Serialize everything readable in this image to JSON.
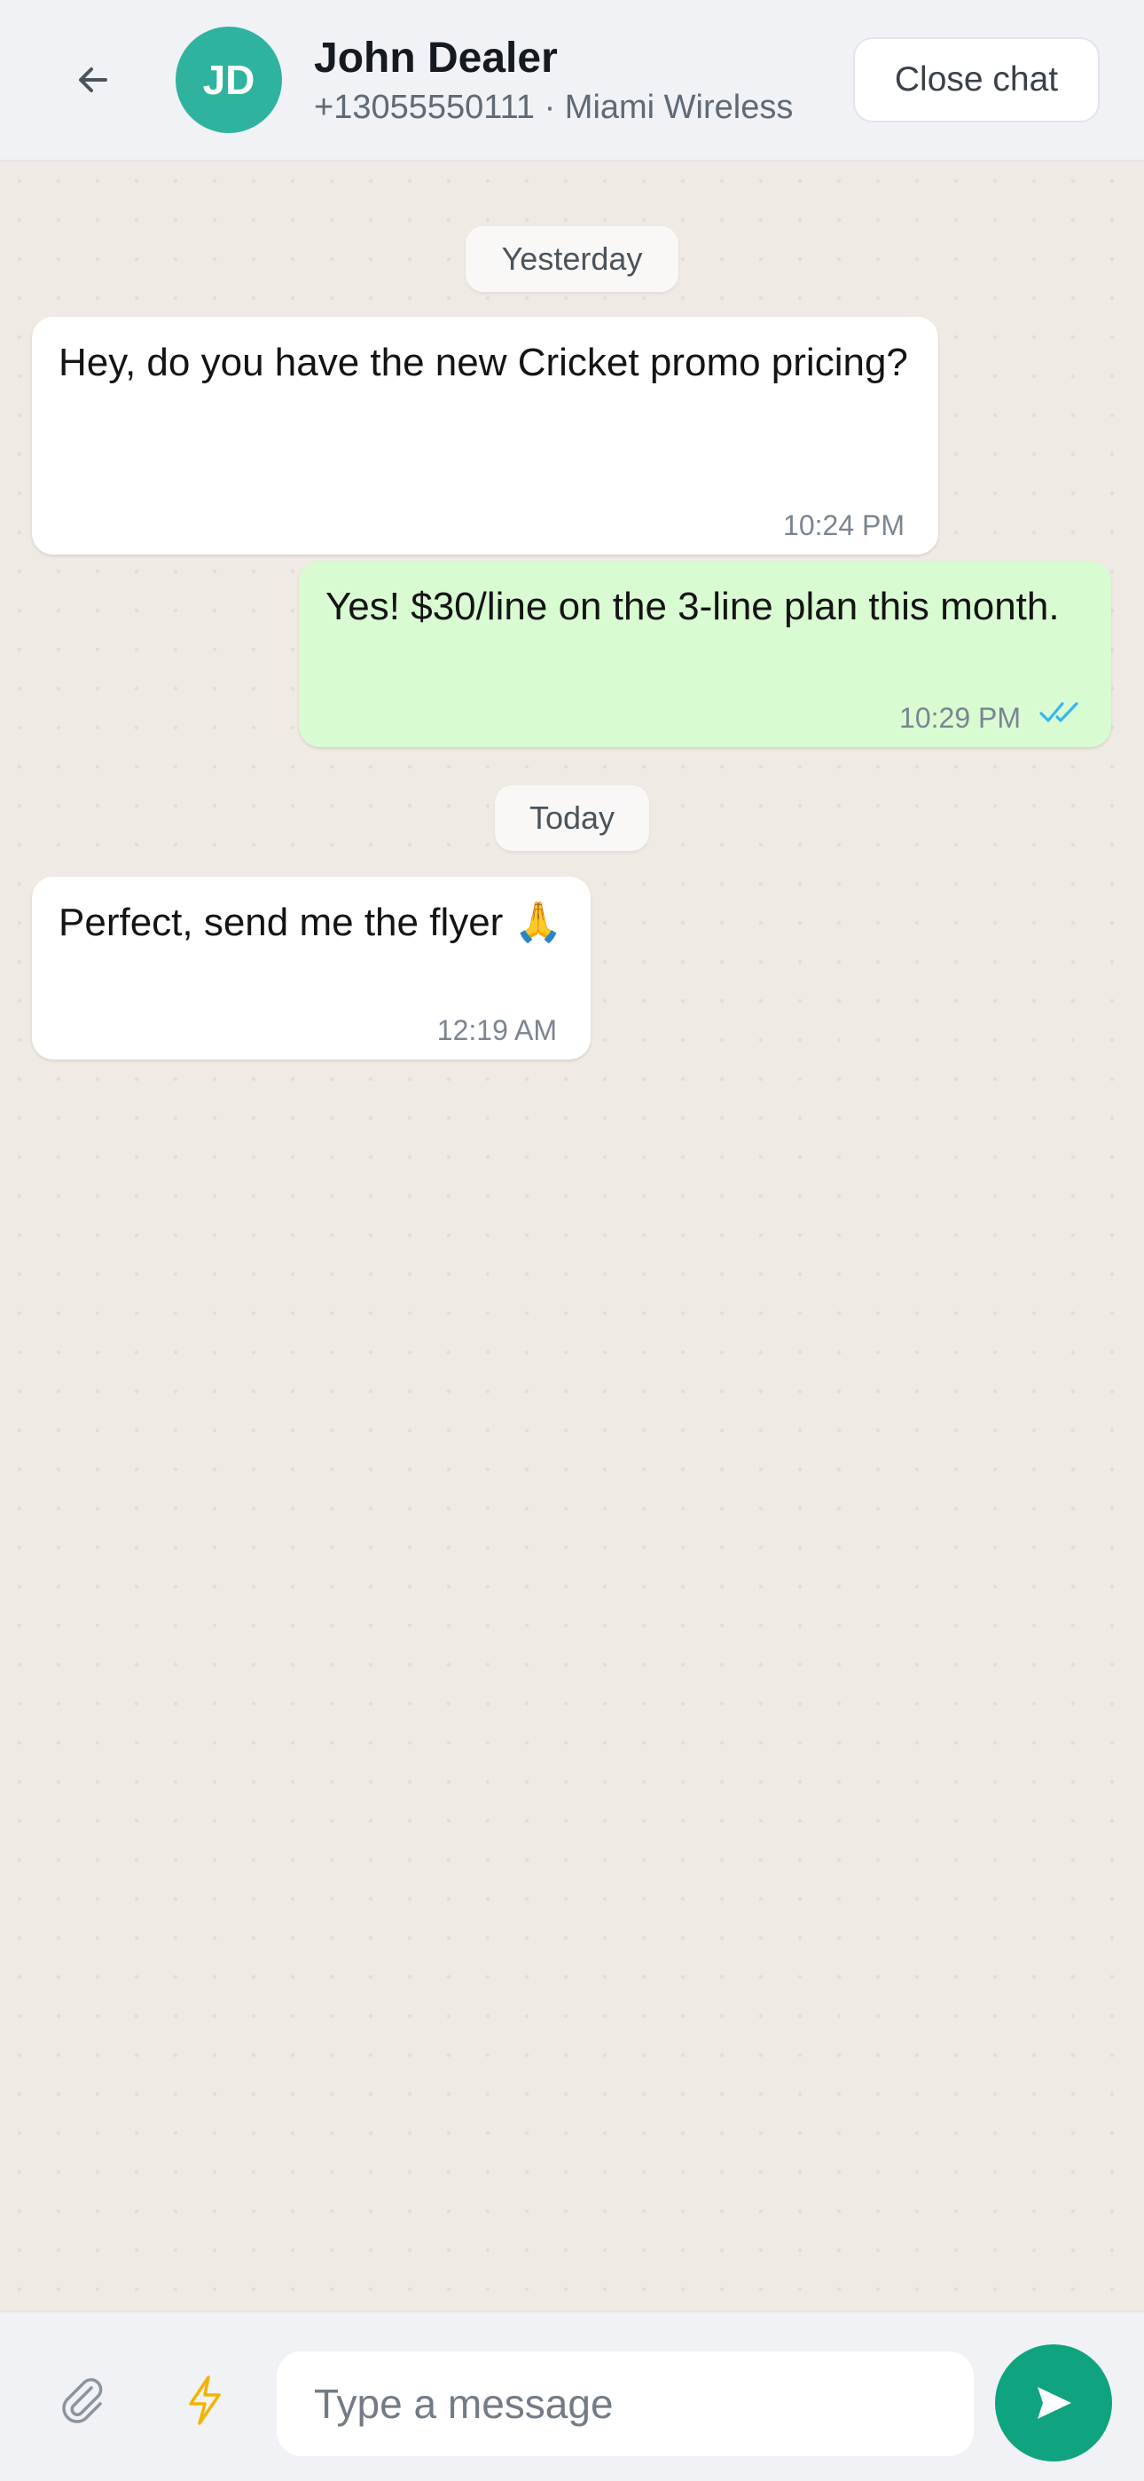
{
  "header": {
    "avatar_initials": "JD",
    "contact_name": "John Dealer",
    "contact_subtitle": "+13055550111 · Miami Wireless",
    "close_label": "Close chat"
  },
  "dates": {
    "yesterday": "Yesterday",
    "today": "Today"
  },
  "messages": [
    {
      "direction": "incoming",
      "text": "Hey, do you have the new Cricket promo pricing?",
      "time": "10:24 PM"
    },
    {
      "direction": "outgoing",
      "text": "Yes! $30/line on the 3-line plan this month.",
      "time": "10:29 PM",
      "status": "read"
    },
    {
      "direction": "incoming",
      "text": "Perfect, send me the flyer 🙏",
      "time": "12:19 AM"
    }
  ],
  "composer": {
    "placeholder": "Type a message"
  },
  "icons": {
    "back": "arrow-left-icon",
    "attach": "paperclip-icon",
    "quick_reply": "lightning-icon",
    "send": "send-icon",
    "read_receipt": "double-check-icon"
  },
  "colors": {
    "accent": "#0fa37f",
    "avatar": "#2fb39f",
    "outgoing_bubble": "#d9fbd2",
    "incoming_bubble": "#ffffff",
    "read_tick": "#34b7f1",
    "bolt": "#f5b301"
  }
}
